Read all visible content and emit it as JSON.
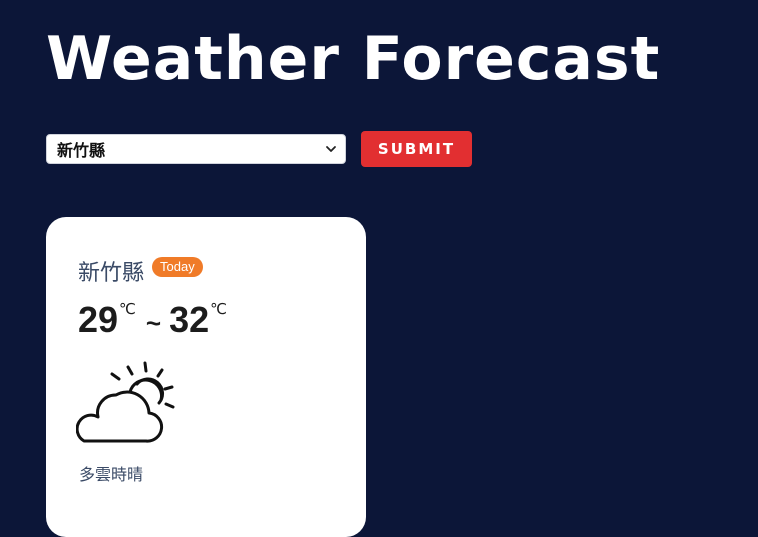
{
  "page": {
    "title": "Weather Forecast"
  },
  "controls": {
    "selected_city": "新竹縣",
    "submit_label": "SUBMIT"
  },
  "card": {
    "city": "新竹縣",
    "badge": "Today",
    "temp_min": "29",
    "temp_max": "32",
    "temp_unit": "℃",
    "temp_separator": "~",
    "weather_icon": "partly-cloudy-icon",
    "description": "多雲時晴"
  },
  "colors": {
    "background": "#0c1638",
    "submit": "#e22f31",
    "badge": "#f07b28",
    "card": "#ffffff"
  }
}
